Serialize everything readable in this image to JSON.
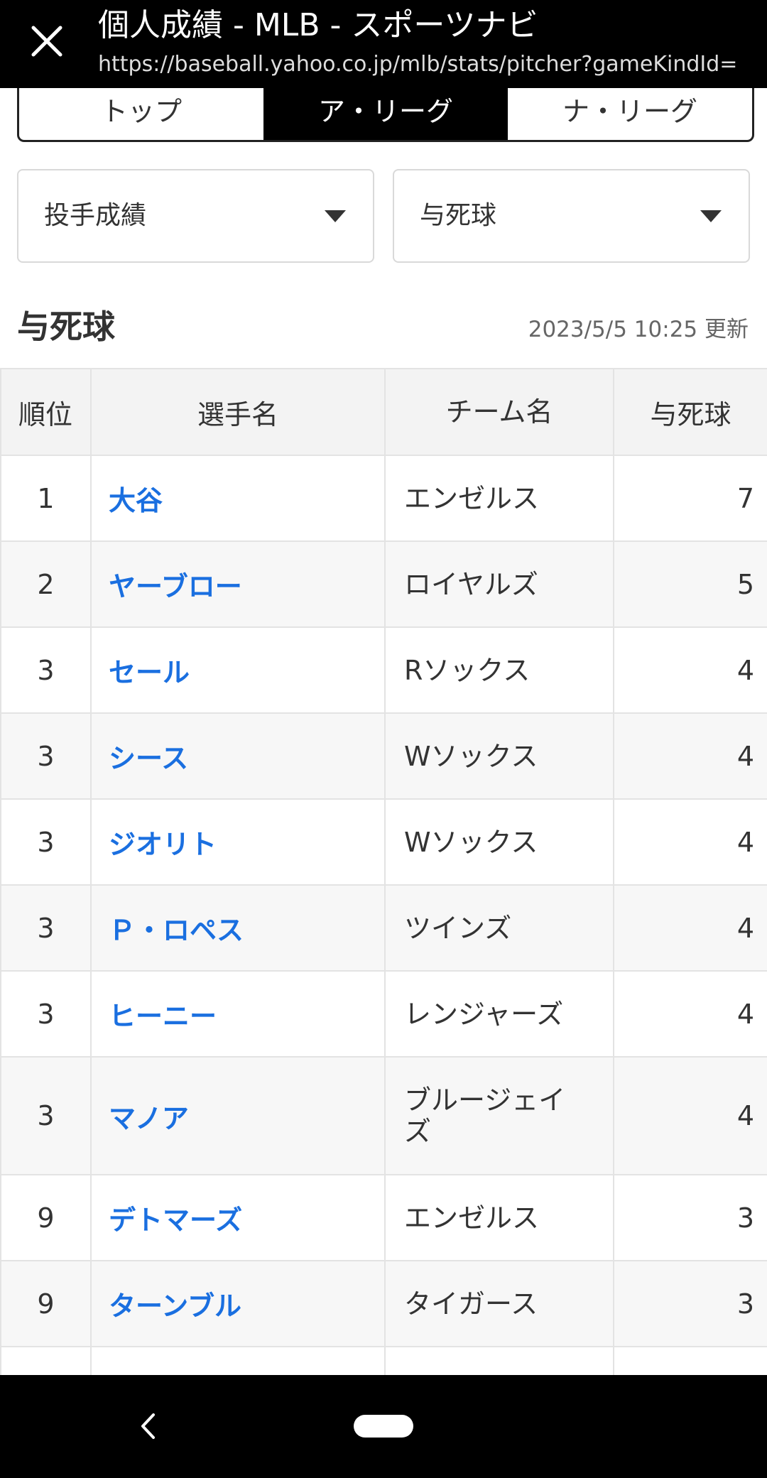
{
  "browser": {
    "title": "個人成績 - MLB - スポーツナビ",
    "url": "https://baseball.yahoo.co.jp/mlb/stats/pitcher?gameKindId=",
    "close_icon": "close-icon"
  },
  "league_tabs": [
    {
      "label": "トップ",
      "active": false
    },
    {
      "label": "ア・リーグ",
      "active": true
    },
    {
      "label": "ナ・リーグ",
      "active": false
    }
  ],
  "filters": {
    "category": "投手成績",
    "stat": "与死球"
  },
  "section": {
    "title": "与死球",
    "updated": "2023/5/5 10:25 更新"
  },
  "table": {
    "headers": [
      "順位",
      "選手名",
      "チーム名",
      "与死球"
    ],
    "rows": [
      {
        "rank": "1",
        "name": "大谷",
        "team": "エンゼルス",
        "value": "7"
      },
      {
        "rank": "2",
        "name": "ヤーブロー",
        "team": "ロイヤルズ",
        "value": "5"
      },
      {
        "rank": "3",
        "name": "セール",
        "team": "Rソックス",
        "value": "4"
      },
      {
        "rank": "3",
        "name": "シース",
        "team": "Wソックス",
        "value": "4"
      },
      {
        "rank": "3",
        "name": "ジオリト",
        "team": "Wソックス",
        "value": "4"
      },
      {
        "rank": "3",
        "name": "Ｐ・ロペス",
        "team": "ツインズ",
        "value": "4"
      },
      {
        "rank": "3",
        "name": "ヒーニー",
        "team": "レンジャーズ",
        "value": "4"
      },
      {
        "rank": "3",
        "name": "マノア",
        "team": "ブルージェイズ",
        "value": "4"
      },
      {
        "rank": "9",
        "name": "デトマーズ",
        "team": "エンゼルス",
        "value": "3"
      },
      {
        "rank": "9",
        "name": "ターンブル",
        "team": "タイガース",
        "value": "3"
      }
    ]
  },
  "system_nav": {
    "back_icon": "back-chevron-icon",
    "home_icon": "home-pill-icon"
  }
}
